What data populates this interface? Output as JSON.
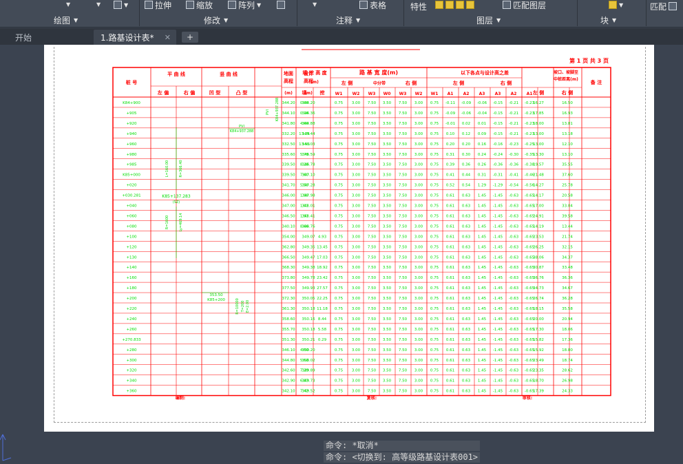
{
  "ribbon": {
    "tools": {
      "stretch": "拉伸",
      "scale": "缩放",
      "array": "阵列",
      "table": "表格",
      "properties": "特性",
      "match_layer": "匹配图层",
      "match": "匹配"
    },
    "sections": {
      "draw": "绘图",
      "modify": "修改",
      "annotate": "注释",
      "layers": "图层",
      "block": "块"
    }
  },
  "tabs": {
    "start": "开始",
    "file": "1.路基设计表*",
    "close": "✕",
    "add": "+"
  },
  "command": {
    "line1": "命令: *取消*",
    "line2": "命令:  <切换到: 高等级路基设计表001>"
  },
  "sheet": {
    "page_label": "第 1 页 共 3 页",
    "headers": {
      "station": "桩  号",
      "plan_curve": "平  曲  线",
      "plan_left": "左  偏",
      "plan_right": "右  偏",
      "vert_curve": "竖  曲  线",
      "vert_concave": "凹  型",
      "vert_convex": "凸  型",
      "ground_elev": "地面高程",
      "design_elev": "设计高程",
      "elev_unit": "(m)",
      "cutfill": "填 挖 高 度",
      "cutfill_unit": "(m)",
      "fill": "填",
      "cut": "挖",
      "width": "路  基  宽  度(m)",
      "left_side": "左  侧",
      "median": "中分带",
      "right_side": "右  侧",
      "diff": "以下各点与设计高之差",
      "diff_left": "左  侧",
      "diff_right": "右  侧",
      "ditch": "坡口、坡脚至中桩距离(m)",
      "ditch_left": "左 侧",
      "ditch_right": "右 侧",
      "remark": "备  注"
    },
    "width_cols": [
      "W1",
      "W2",
      "W3",
      "W0",
      "W3",
      "W2",
      "W1"
    ],
    "diff_cols": [
      "A1",
      "A2",
      "A3",
      "A3",
      "A2",
      "A1"
    ],
    "footer": {
      "drawn": "编制:",
      "review": "复核:",
      "approve": "审核:"
    },
    "annotations": {
      "hz1": "L=160.00",
      "hz2": "R=366.40",
      "hz3": "K85+137.283",
      "hz4": "(SZ)",
      "hz5": "R=1600",
      "hz6": "Ly=469.14",
      "vc1": "PVI",
      "vc2": "K84+937.288",
      "vc3": "353.50",
      "vc4": "K85+200",
      "vc5": "R=10000",
      "vc6": "T=200",
      "vc7": "E=2.00"
    },
    "rows": [
      [
        "K84+900",
        "344.20",
        "344.20",
        "0.00",
        "",
        "0.75",
        "3.00",
        "7.50",
        "3.50",
        "7.50",
        "3.00",
        "0.75",
        "-0.11",
        "-0.09",
        "-0.06",
        "-0.15",
        "-0.21",
        "-0.23",
        "16.27",
        "16.50"
      ],
      [
        "+905",
        "344.10",
        "344.36",
        "0.16",
        "",
        "0.75",
        "3.00",
        "7.50",
        "3.50",
        "7.50",
        "3.00",
        "0.75",
        "-0.09",
        "-0.06",
        "-0.04",
        "-0.15",
        "-0.21",
        "-0.23",
        "17.85",
        "16.93"
      ],
      [
        "+920",
        "341.80",
        "344.88",
        "4.60",
        "",
        "0.75",
        "3.00",
        "7.50",
        "3.50",
        "7.50",
        "3.00",
        "0.75",
        "-0.01",
        "0.02",
        "0.01",
        "-0.15",
        "-0.21",
        "-0.23",
        "18.00",
        "13.81"
      ],
      [
        "+940",
        "332.20",
        "345.44",
        "13.24",
        "",
        "0.75",
        "3.00",
        "7.50",
        "3.50",
        "7.50",
        "3.00",
        "0.75",
        "0.10",
        "0.12",
        "0.09",
        "-0.15",
        "-0.21",
        "-0.23",
        "13.00",
        "13.18"
      ],
      [
        "+960",
        "332.50",
        "346.03",
        "13.53",
        "",
        "0.75",
        "3.00",
        "7.50",
        "3.50",
        "7.50",
        "3.00",
        "0.75",
        "0.20",
        "0.20",
        "0.16",
        "-0.16",
        "-0.23",
        "-0.25",
        "13.00",
        "12.10"
      ],
      [
        "+980",
        "335.60",
        "346.59",
        "5.79",
        "",
        "0.75",
        "3.00",
        "7.50",
        "3.50",
        "7.50",
        "3.00",
        "0.75",
        "0.31",
        "0.30",
        "0.24",
        "-0.24",
        "-0.30",
        "-0.35",
        "13.30",
        "13.10"
      ],
      [
        "+985",
        "339.50",
        "346.78",
        "8.28",
        "",
        "0.75",
        "3.00",
        "7.50",
        "3.50",
        "7.50",
        "3.00",
        "0.75",
        "0.39",
        "0.36",
        "0.26",
        "-0.36",
        "-0.36",
        "-0.38",
        "19.57",
        "35.55"
      ],
      [
        "K85+000",
        "339.50",
        "347.10",
        "7.60",
        "",
        "0.75",
        "3.00",
        "7.50",
        "3.50",
        "7.50",
        "3.00",
        "0.75",
        "0.41",
        "0.44",
        "0.31",
        "-0.31",
        "-0.41",
        "-0.46",
        "21.48",
        "37.60"
      ],
      [
        "+020",
        "341.70",
        "347.28",
        "5.58",
        "",
        "0.75",
        "3.00",
        "7.50",
        "3.50",
        "7.50",
        "3.00",
        "0.75",
        "0.52",
        "0.54",
        "1.29",
        "-1.29",
        "-0.54",
        "-0.56",
        "14.27",
        "25.78"
      ],
      [
        "+030.281",
        "346.00",
        "347.98",
        "1.98",
        "",
        "0.75",
        "3.00",
        "7.50",
        "3.50",
        "7.50",
        "3.00",
        "0.75",
        "0.61",
        "0.63",
        "1.45",
        "-1.45",
        "-0.63",
        "-0.65",
        "14.17",
        "20.58"
      ],
      [
        "+040",
        "347.00",
        "348.01",
        "1.01",
        "",
        "0.75",
        "3.00",
        "7.50",
        "3.50",
        "7.50",
        "3.00",
        "0.75",
        "0.61",
        "0.63",
        "1.45",
        "-1.45",
        "-0.63",
        "-0.65",
        "17.00",
        "33.04"
      ],
      [
        "+060",
        "346.50",
        "348.41",
        "1.91",
        "",
        "0.75",
        "3.00",
        "7.50",
        "3.50",
        "7.50",
        "3.00",
        "0.75",
        "0.61",
        "0.63",
        "1.45",
        "-1.45",
        "-0.63",
        "-0.65",
        "24.91",
        "39.58"
      ],
      [
        "+080",
        "340.10",
        "348.76",
        "8.66",
        "",
        "0.75",
        "3.00",
        "7.50",
        "3.50",
        "7.50",
        "3.00",
        "0.75",
        "0.61",
        "0.63",
        "1.45",
        "-1.45",
        "-0.63",
        "-0.65",
        "14.19",
        "13.44"
      ],
      [
        "+100",
        "354.00",
        "349.07",
        "",
        "4.93",
        "0.75",
        "3.00",
        "7.50",
        "3.50",
        "7.50",
        "3.00",
        "0.75",
        "0.61",
        "0.63",
        "1.45",
        "-1.45",
        "-0.63",
        "-0.65",
        "23.53",
        "21.74"
      ],
      [
        "+120",
        "362.80",
        "349.35",
        "",
        "13.45",
        "0.75",
        "3.00",
        "7.50",
        "3.50",
        "7.50",
        "3.00",
        "0.75",
        "0.61",
        "0.63",
        "1.45",
        "-1.45",
        "-0.63",
        "-0.65",
        "26.25",
        "32.15"
      ],
      [
        "+130",
        "366.50",
        "349.47",
        "",
        "17.03",
        "0.75",
        "3.00",
        "7.50",
        "3.50",
        "7.50",
        "3.00",
        "0.75",
        "0.61",
        "0.63",
        "1.45",
        "-1.45",
        "-0.63",
        "-0.65",
        "38.06",
        "34.37"
      ],
      [
        "+140",
        "368.30",
        "349.38",
        "",
        "18.92",
        "0.75",
        "3.00",
        "7.50",
        "3.50",
        "7.50",
        "3.00",
        "0.75",
        "0.61",
        "0.63",
        "1.45",
        "-1.45",
        "-0.63",
        "-0.65",
        "30.87",
        "33.48"
      ],
      [
        "+160",
        "373.80",
        "349.78",
        "",
        "23.42",
        "0.75",
        "3.00",
        "7.50",
        "3.50",
        "7.50",
        "3.00",
        "0.75",
        "0.61",
        "0.63",
        "1.45",
        "-1.45",
        "-0.63",
        "-0.65",
        "36.76",
        "36.36"
      ],
      [
        "+180",
        "377.50",
        "349.93",
        "",
        "27.57",
        "0.75",
        "3.00",
        "7.50",
        "3.50",
        "7.50",
        "3.00",
        "0.75",
        "0.61",
        "0.63",
        "1.45",
        "-1.45",
        "-0.63",
        "-0.65",
        "34.73",
        "34.67"
      ],
      [
        "+200",
        "372.30",
        "350.05",
        "",
        "22.25",
        "0.75",
        "3.00",
        "7.50",
        "3.50",
        "7.50",
        "3.00",
        "0.75",
        "0.61",
        "0.63",
        "1.45",
        "-1.45",
        "-0.63",
        "-0.65",
        "26.74",
        "36.28"
      ],
      [
        "+220",
        "361.30",
        "350.18",
        "",
        "11.18",
        "0.75",
        "3.00",
        "7.50",
        "3.50",
        "7.50",
        "3.00",
        "0.75",
        "0.61",
        "0.63",
        "1.45",
        "-1.45",
        "-0.63",
        "-0.65",
        "18.15",
        "35.58"
      ],
      [
        "+240",
        "358.60",
        "350.16",
        "",
        "8.44",
        "0.75",
        "3.00",
        "7.50",
        "3.50",
        "7.50",
        "3.00",
        "0.75",
        "0.61",
        "0.63",
        "1.45",
        "-1.45",
        "-0.63",
        "-0.65",
        "20.00",
        "20.94"
      ],
      [
        "+260",
        "355.70",
        "350.18",
        "",
        "5.58",
        "0.75",
        "3.00",
        "7.50",
        "3.50",
        "7.50",
        "3.00",
        "0.75",
        "0.61",
        "0.63",
        "1.45",
        "-1.45",
        "-0.63",
        "-0.65",
        "17.30",
        "18.06"
      ],
      [
        "+270.833",
        "351.30",
        "350.21",
        "",
        "0.29",
        "0.75",
        "3.00",
        "7.50",
        "3.50",
        "7.50",
        "3.00",
        "0.75",
        "0.61",
        "0.63",
        "1.45",
        "-1.45",
        "-0.63",
        "-0.65",
        "15.82",
        "17.36"
      ],
      [
        "+280",
        "346.10",
        "350.20",
        "4.00",
        "",
        "0.75",
        "3.00",
        "7.50",
        "3.50",
        "7.50",
        "3.00",
        "0.75",
        "0.61",
        "0.63",
        "1.45",
        "-1.45",
        "-0.63",
        "-0.65",
        "15.92",
        "18.80"
      ],
      [
        "+300",
        "344.80",
        "350.02",
        "5.68",
        "",
        "0.75",
        "3.00",
        "7.50",
        "3.50",
        "7.50",
        "3.00",
        "0.75",
        "0.61",
        "0.63",
        "1.45",
        "-1.45",
        "-0.63",
        "-0.65",
        "23.49",
        "18.74"
      ],
      [
        "+320",
        "342.60",
        "349.89",
        "7.29",
        "",
        "0.75",
        "3.00",
        "7.50",
        "3.50",
        "7.50",
        "3.00",
        "0.75",
        "0.61",
        "0.63",
        "1.45",
        "-1.45",
        "-0.63",
        "-0.65",
        "23.35",
        "28.62"
      ],
      [
        "+340",
        "342.90",
        "349.73",
        "6.83",
        "",
        "0.75",
        "3.00",
        "7.50",
        "3.50",
        "7.50",
        "3.00",
        "0.75",
        "0.61",
        "0.63",
        "1.45",
        "-1.45",
        "-0.63",
        "-0.65",
        "18.70",
        "26.98"
      ],
      [
        "+360",
        "342.10",
        "349.52",
        "7.42",
        "",
        "0.75",
        "3.00",
        "7.50",
        "3.50",
        "7.50",
        "3.00",
        "0.75",
        "0.61",
        "0.63",
        "1.45",
        "-1.45",
        "-0.63",
        "-0.65",
        "17.39",
        "24.33"
      ]
    ]
  },
  "colors": {
    "grid": "#ff0000",
    "values": "#00dd00",
    "ribbon": "#434b57",
    "canvas": "#3b4350"
  }
}
